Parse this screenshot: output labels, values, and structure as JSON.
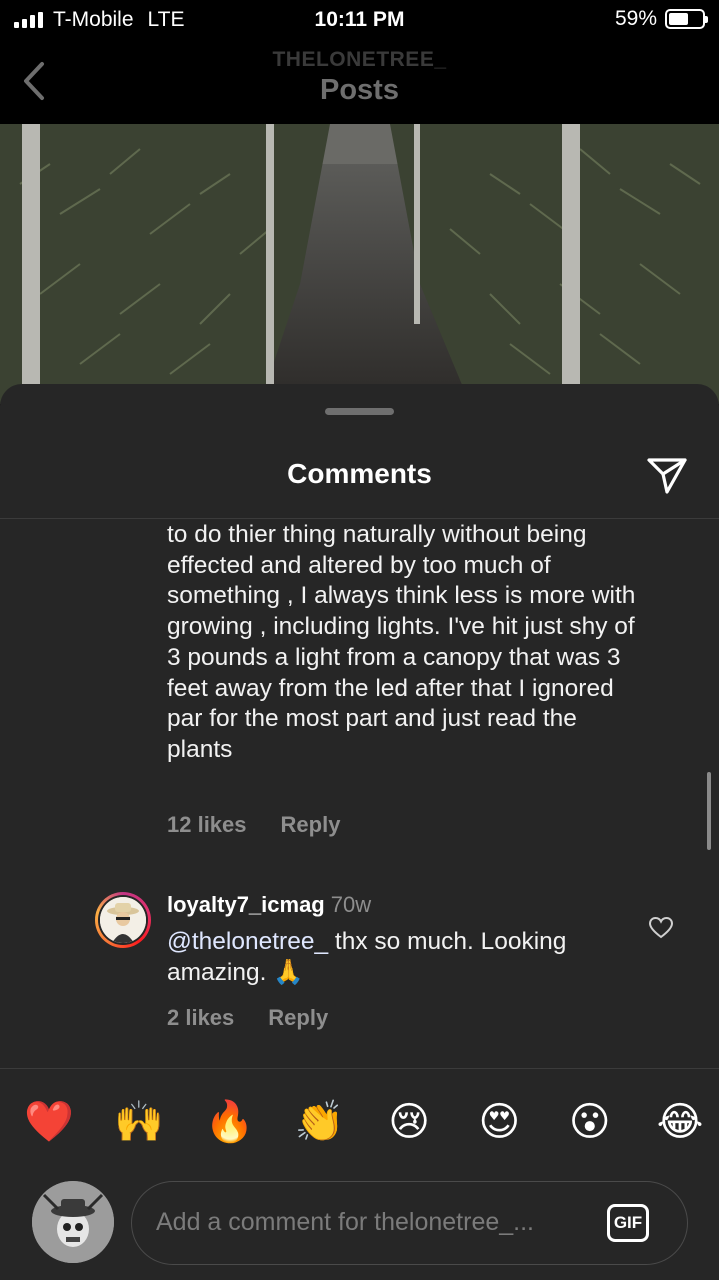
{
  "status_bar": {
    "carrier": "T-Mobile",
    "network": "LTE",
    "time": "10:11 PM",
    "battery_percent": "59%",
    "battery_level": 0.59
  },
  "header": {
    "username": "THELONETREE_",
    "title": "Posts"
  },
  "comments_sheet": {
    "title": "Comments",
    "previous_comment": {
      "text": "to do thier thing naturally without being effected and altered by too much of something ,  I always think less is more with growing , including lights. I've hit just shy of 3 pounds a light from a canopy that was 3 feet away from the led after that I ignored par for the most part and just read the plants",
      "likes": "12 likes",
      "reply_label": "Reply"
    },
    "reply_comment": {
      "username": "loyalty7_icmag",
      "age": "70w",
      "mention": "@thelonetree_",
      "text": "  thx so much. Looking amazing. 🙏",
      "likes": "2 likes",
      "reply_label": "Reply"
    },
    "quick_emojis": [
      "❤️",
      "🙌",
      "🔥",
      "👏",
      "😢",
      "😍",
      "😮",
      "😂"
    ],
    "input": {
      "placeholder": "Add a comment for thelonetree_...",
      "gif_label": "GIF"
    }
  },
  "colors": {
    "sheet_background": "#262626",
    "secondary_text": "#8e8e8e",
    "divider": "#3b3b3b"
  }
}
